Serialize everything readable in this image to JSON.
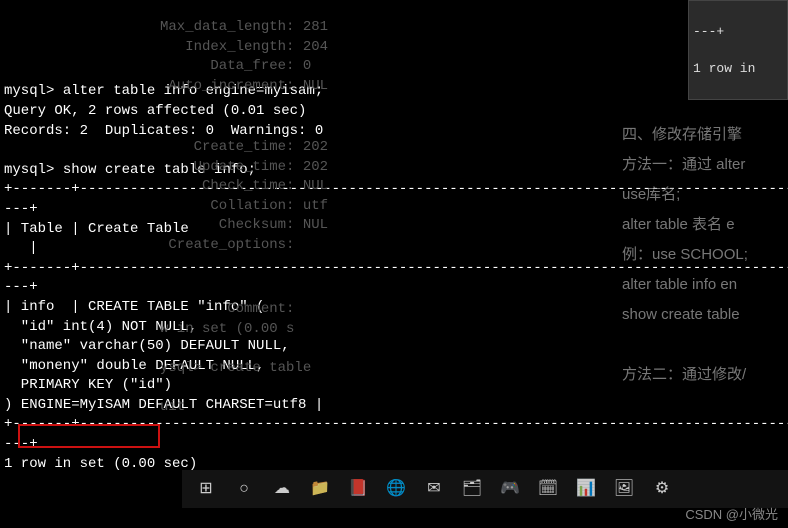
{
  "terminal": {
    "cmd1_prompt": "mysql> ",
    "cmd1": "alter table info engine=myisam;",
    "cmd1_res1": "Query OK, 2 rows affected (0.01 sec)",
    "cmd1_res2": "Records: 2  Duplicates: 0  Warnings: 0",
    "blank": "",
    "cmd2_prompt": "mysql> ",
    "cmd2": "show create table info;",
    "border_seg": "+-------+---------------------------------------------------------------------------------------------------",
    "border_tail": "---+",
    "header_row": "| Table | Create Table",
    "header_pad": "   |",
    "body_l1": "| info  | CREATE TABLE \"info\" (",
    "body_l2": "  \"id\" int(4) NOT NULL,",
    "body_l3": "  \"name\" varchar(50) DEFAULT NULL,",
    "body_l4": "  \"moneny\" double DEFAULT NULL,",
    "body_l5": "  PRIMARY KEY (\"id\")",
    "body_l6_a": ") ",
    "body_l6_engine": "ENGINE=MyISAM",
    "body_l6_b": " DEFAULT CHARSET=utf8 |",
    "footer": "1 row in set (0.00 sec)"
  },
  "ghost": {
    "block1_l1": "Max_data_length: 281",
    "block1_l2": "   Index_length: 204",
    "block1_l3": "      Data_free: 0",
    "block1_l4": " Auto_increment: NUL",
    "block2_l1": "    Create_time: 202",
    "block2_l2": "    Update_time: 202",
    "block2_l3": "     Check_time: NUL",
    "block2_l4": "      Collation: utf",
    "block2_l5": "       Checksum: NUL",
    "block2_l6": " Create_options:",
    "block3_l1": "        Comment:",
    "block3_l2": "w in set (0.00 s",
    "block3_l3": "ysql> create table",
    "block3_l4": "uit"
  },
  "right_top": {
    "dashes": "---+",
    "row": "1 row in"
  },
  "right_panel": {
    "t1": "四、修改存储引擎",
    "t2": "方法一：通过 alter",
    "t3": "use库名;",
    "t4": "alter table 表名 e",
    "t5": "例：use SCHOOL;",
    "t6": "alter table info en",
    "t7": "show create table",
    "t8": "方法二：通过修改/"
  },
  "taskbar": {
    "icons": [
      "⊞",
      "○",
      "☁",
      "📁",
      "📕",
      "🌐",
      "✉",
      "🗂",
      "🎮",
      "🗓",
      "📊",
      "🖼",
      "⚙"
    ]
  },
  "watermark": "CSDN @小微光"
}
